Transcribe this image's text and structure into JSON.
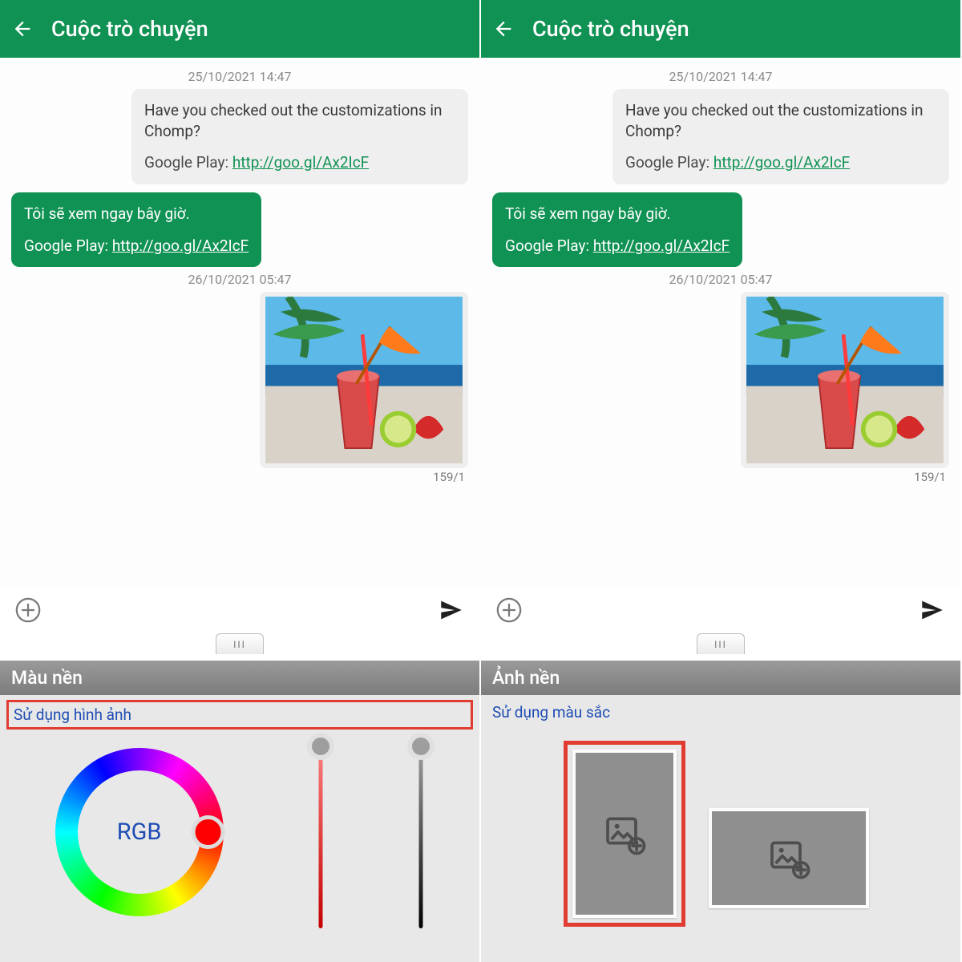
{
  "header": {
    "title": "Cuộc trò chuyện"
  },
  "timestamps": {
    "ts1": "25/10/2021 14:47",
    "ts2": "26/10/2021 05:47"
  },
  "incoming": {
    "line1": "Have you checked out the customizations in Chomp?",
    "gp_label": "Google Play: ",
    "link": "http://goo.gl/Ax2IcF"
  },
  "outgoing": {
    "line1": "Tôi sẽ xem ngay bây giờ.",
    "gp_label": "Google Play: ",
    "link": "http://goo.gl/Ax2IcF"
  },
  "counter": "159/1",
  "left_panel": {
    "title": "Màu nền",
    "link": "Sử dụng hình ảnh",
    "rgb_label": "RGB"
  },
  "right_panel": {
    "title": "Ảnh nền",
    "link": "Sử dụng màu sắc"
  }
}
